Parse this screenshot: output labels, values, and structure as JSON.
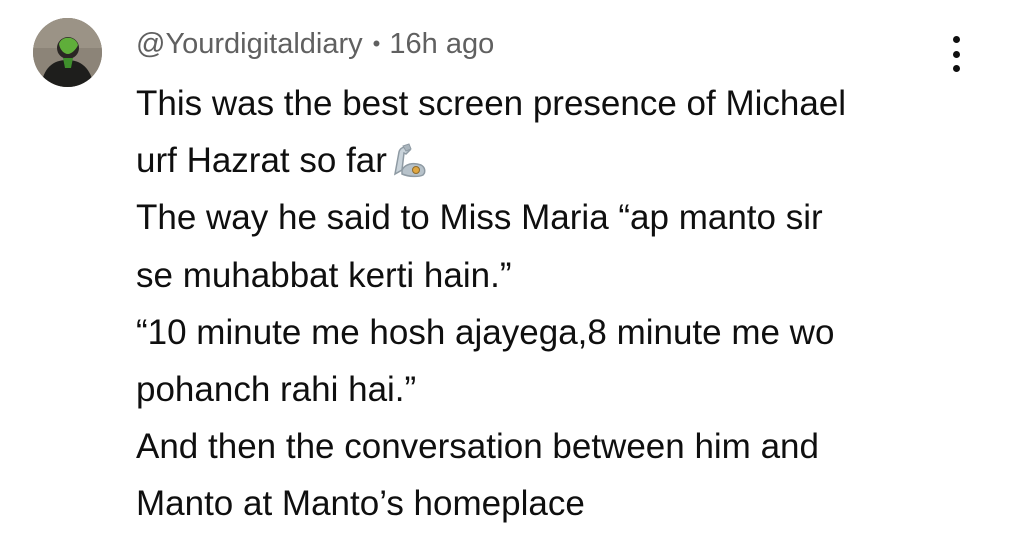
{
  "comment": {
    "author": "@Yourdigitaldiary",
    "separator": "•",
    "timestamp": "16h ago",
    "avatar_icon": "user-avatar-icon",
    "more_icon": "vertical-dots-icon",
    "emoji_icon": "mechanical-arm-emoji",
    "lines": [
      "This was the best screen presence of Michael",
      "urf Hazrat so far",
      "The way he said to Miss Maria “ap manto sir",
      "se muhabbat kerti hain.”",
      "“10 minute me hosh ajayega,8 minute me wo",
      "pohanch rahi hai.”",
      "And then the conversation between him and",
      "Manto at Manto’s homeplace"
    ]
  }
}
